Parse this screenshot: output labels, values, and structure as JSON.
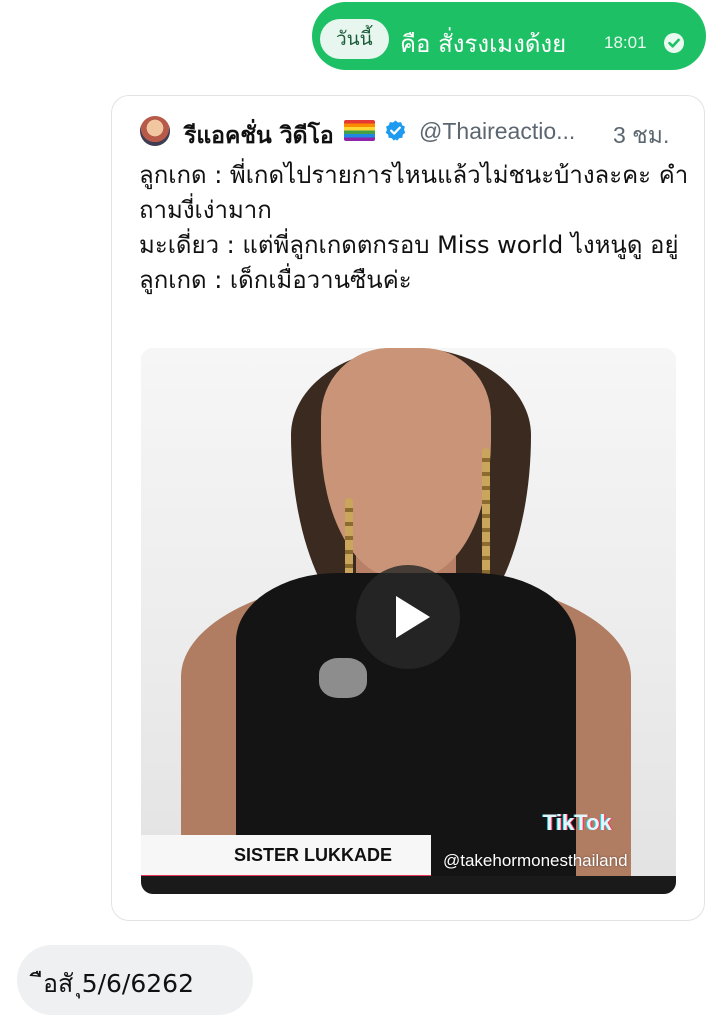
{
  "chat": {
    "date_pill": "วันนี้",
    "outgoing": {
      "text": "คือ สั่งรงเมงด้งย",
      "time": "18:01",
      "status_icon": "read-check-icon"
    },
    "incoming": {
      "text": "ือสั ุ5/6/6262"
    }
  },
  "tweet": {
    "author": "รีแอคชั่น วิดีโอ",
    "author_flag": "rainbow-flag",
    "verified_icon": "verified-badge-icon",
    "handle": "@Thaireactio...",
    "age": "3 ชม.",
    "lines": [
      "ลูกเกด : พี่เกดไปรายการไหนแล้วไม่ชนะบ้างละคะ คำถามงี่เง่ามาก",
      "มะเดี่ยว : แต่พี่ลูกเกดตกรอบ Miss world ไงหนูดู อยู่",
      "ลูกเกด : เด็กเมื่อวานซืนค่ะ"
    ],
    "video": {
      "play_icon": "play-icon",
      "tiktok_logo": "TikTok",
      "lower_third_name": "SISTER LUKKADE",
      "watermark": "@takehormonesthailand"
    }
  },
  "colors": {
    "outgoing_bubble": "#1ec065",
    "incoming_bubble": "#eff0f1",
    "verified": "#1d9bf0",
    "handle": "#5b6670"
  }
}
